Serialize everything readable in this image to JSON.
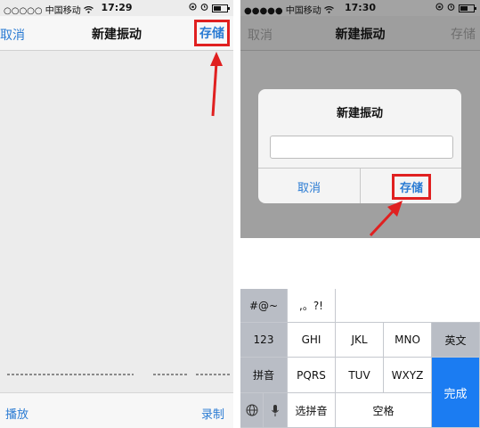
{
  "left": {
    "status": {
      "carrier": "○○○○○ 中国移动",
      "time": "17:29",
      "battery_level": 0.6
    },
    "nav": {
      "left": "取消",
      "title": "新建振动",
      "right": "存储"
    },
    "bottom": {
      "play": "播放",
      "record": "录制"
    }
  },
  "right": {
    "status": {
      "carrier": "●●●●● 中国移动",
      "time": "17:30",
      "battery_level": 0.6
    },
    "nav": {
      "left": "取消",
      "title": "新建振动",
      "right": "存储"
    },
    "dialog": {
      "title": "新建振动",
      "cancel": "取消",
      "save": "存储",
      "input_value": ""
    },
    "keyboard": {
      "symbols": "#@~",
      "punct": ",。?!",
      "k123": "123",
      "ghi": "GHI",
      "jkl": "JKL",
      "mno": "MNO",
      "english": "英文",
      "pinyin": "拼音",
      "pqrs": "PQRS",
      "tuv": "TUV",
      "wxyz": "WXYZ",
      "done": "完成",
      "select_pinyin": "选拼音",
      "space": "空格"
    }
  },
  "colors": {
    "accent": "#2a7bd3",
    "highlight": "#e02020",
    "done_key": "#1b7cf2"
  },
  "icons": [
    "wifi-icon",
    "alarm-icon",
    "lock-rotation-icon",
    "battery-icon",
    "globe-icon",
    "microphone-icon",
    "arrow-icon"
  ]
}
